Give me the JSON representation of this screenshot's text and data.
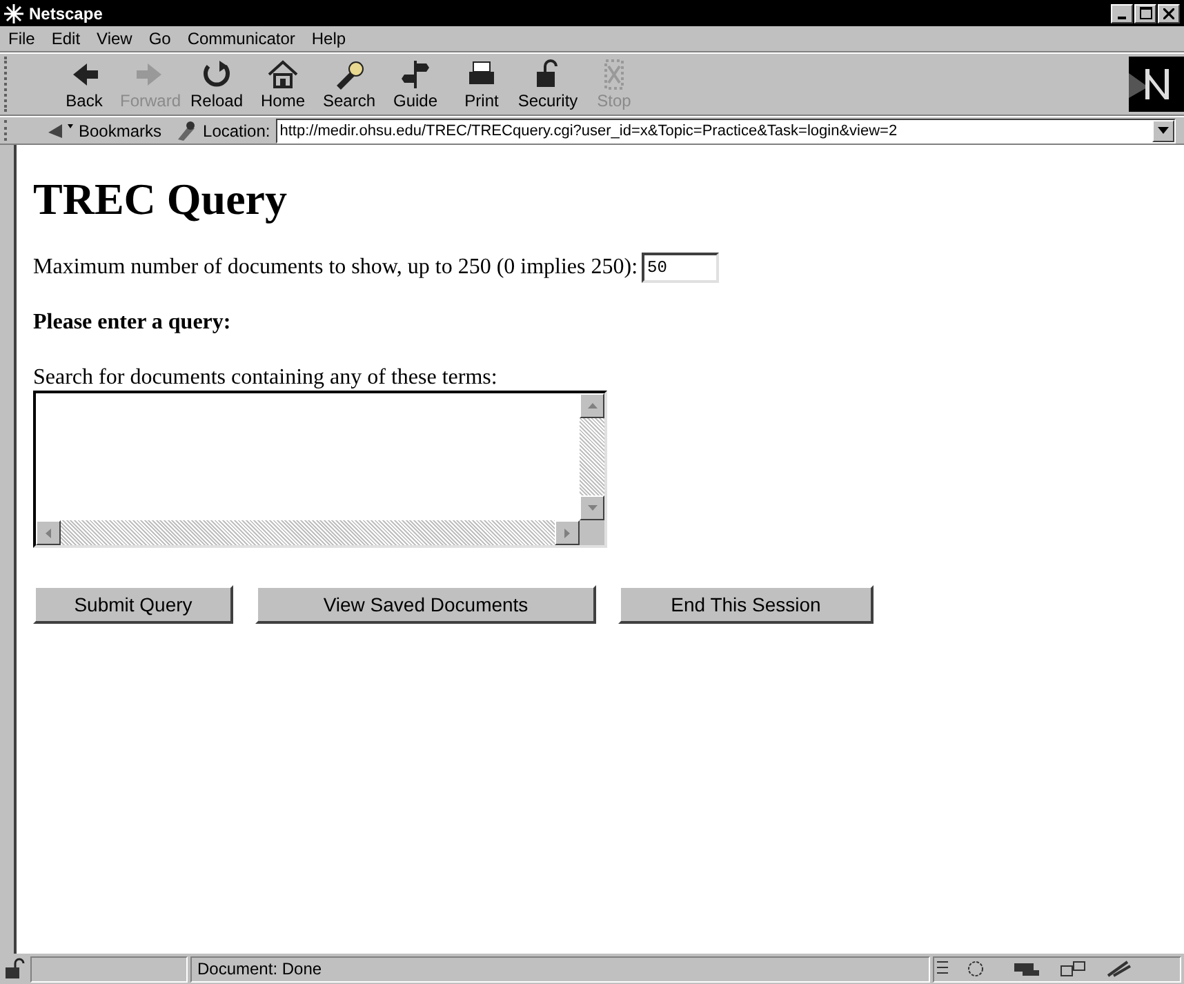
{
  "window": {
    "title": "Netscape"
  },
  "menu": [
    "File",
    "Edit",
    "View",
    "Go",
    "Communicator",
    "Help"
  ],
  "toolbar": [
    {
      "label": "Back",
      "disabled": false
    },
    {
      "label": "Forward",
      "disabled": true
    },
    {
      "label": "Reload",
      "disabled": false
    },
    {
      "label": "Home",
      "disabled": false
    },
    {
      "label": "Search",
      "disabled": false
    },
    {
      "label": "Guide",
      "disabled": false
    },
    {
      "label": "Print",
      "disabled": false
    },
    {
      "label": "Security",
      "disabled": false
    },
    {
      "label": "Stop",
      "disabled": true
    }
  ],
  "location_bar": {
    "bookmarks_label": "Bookmarks",
    "location_label": "Location:",
    "url": "http://medir.ohsu.edu/TREC/TRECquery.cgi?user_id=x&Topic=Practice&Task=login&view=2"
  },
  "page": {
    "heading": "TREC Query",
    "max_docs_label": "Maximum number of documents to show, up to 250 (0 implies 250):",
    "max_docs_value": "50",
    "query_heading": "Please enter a query:",
    "terms_label": "Search for documents containing any of these terms:",
    "buttons": [
      "Submit Query",
      "View Saved Documents",
      "End This Session"
    ]
  },
  "status_bar": {
    "text": "Document: Done"
  }
}
